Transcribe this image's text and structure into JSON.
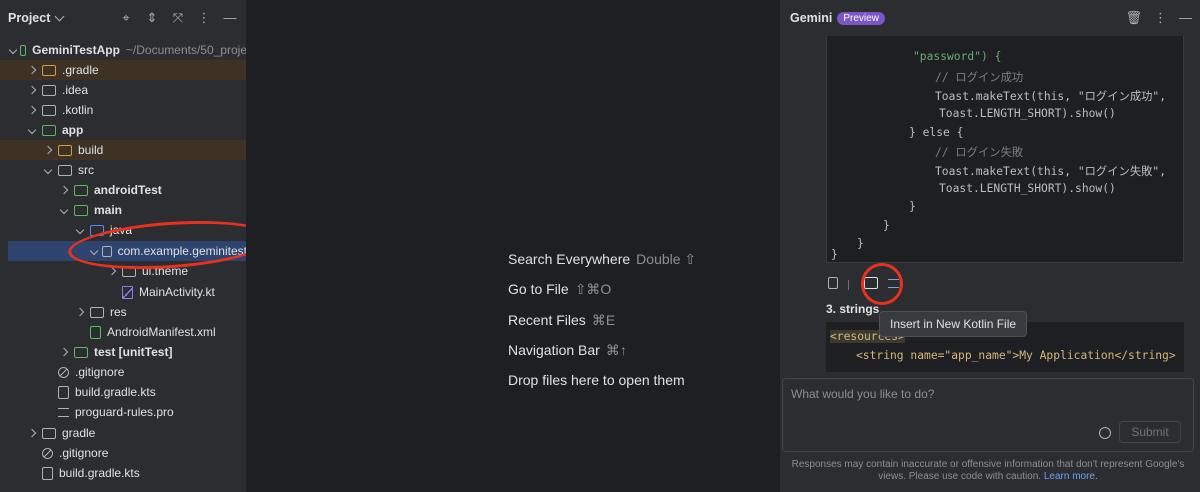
{
  "project_panel": {
    "title": "Project",
    "header_icons": [
      "crosshair-icon",
      "expand-icon",
      "collapse-icon",
      "more-icon",
      "minimize-icon"
    ],
    "tree": [
      {
        "label": "GeminiTestApp",
        "suffix": "~/Documents/50_proje",
        "icon": "module-folder-icon"
      },
      {
        "label": ".gradle",
        "icon": "folder-icon"
      },
      {
        "label": ".idea",
        "icon": "folder-icon"
      },
      {
        "label": ".kotlin",
        "icon": "folder-icon"
      },
      {
        "label": "app",
        "icon": "module-folder-icon"
      },
      {
        "label": "build",
        "icon": "excluded-folder-icon"
      },
      {
        "label": "src",
        "icon": "folder-icon"
      },
      {
        "label": "androidTest",
        "icon": "test-folder-icon"
      },
      {
        "label": "main",
        "icon": "source-root-folder-icon"
      },
      {
        "label": "java",
        "icon": "source-folder-icon"
      },
      {
        "label": "com.example.geminitest",
        "icon": "package-icon"
      },
      {
        "label": "ui.theme",
        "icon": "package-icon"
      },
      {
        "label": "MainActivity.kt",
        "icon": "kotlin-file-icon"
      },
      {
        "label": "res",
        "icon": "resources-folder-icon"
      },
      {
        "label": "AndroidManifest.xml",
        "icon": "android-manifest-icon"
      },
      {
        "label": "test [unitTest]",
        "icon": "test-folder-icon"
      },
      {
        "label": ".gitignore",
        "icon": "gitignore-icon"
      },
      {
        "label": "build.gradle.kts",
        "icon": "gradle-file-icon"
      },
      {
        "label": "proguard-rules.pro",
        "icon": "text-file-icon"
      },
      {
        "label": "gradle",
        "icon": "folder-icon"
      },
      {
        "label": ".gitignore",
        "icon": "gitignore-icon"
      },
      {
        "label": "build.gradle.kts",
        "icon": "gradle-file-icon"
      }
    ]
  },
  "editor_hints": [
    {
      "label": "Search Everywhere",
      "shortcut": "Double ⇧"
    },
    {
      "label": "Go to File",
      "shortcut": "⇧⌘O"
    },
    {
      "label": "Recent Files",
      "shortcut": "⌘E"
    },
    {
      "label": "Navigation Bar",
      "shortcut": "⌘↑"
    },
    {
      "label": "Drop files here to open them",
      "shortcut": ""
    }
  ],
  "gemini_panel": {
    "title": "Gemini",
    "badge": "Preview",
    "header_icons": [
      "trash-icon",
      "more-icon",
      "minimize-icon"
    ],
    "code_lines": [
      {
        "text": "\"password\") {"
      },
      {
        "text": "// ログイン成功"
      },
      {
        "text": "Toast.makeText(this, \"ログイン成功\","
      },
      {
        "text": "Toast.LENGTH_SHORT).show()"
      },
      {
        "text": "} else {"
      },
      {
        "text": "// ログイン失敗"
      },
      {
        "text": "Toast.makeText(this, \"ログイン失敗\","
      },
      {
        "text": "Toast.LENGTH_SHORT).show()"
      },
      {
        "text": "}"
      },
      {
        "text": "}"
      },
      {
        "text": "}"
      },
      {
        "text": "}"
      }
    ],
    "code_tool_icons": [
      "copy-icon",
      "insert-at-caret-icon",
      "insert-new-file-icon",
      "explain-icon"
    ],
    "section_heading": "3. strings",
    "tooltip": "Insert in New Kotlin File",
    "xml_lines": [
      {
        "text": "<resources>"
      },
      {
        "text": "<string name=\"app_name\">My Application</string>"
      }
    ],
    "prompt": {
      "placeholder": "What would you like to do?",
      "value": "",
      "submit_label": "Submit"
    },
    "disclaimer": "Responses may contain inaccurate or offensive information that don't represent Google's views. Please use code with caution.",
    "learn_more": "Learn more."
  },
  "annotations": {
    "ring_color": "#e8321f"
  }
}
